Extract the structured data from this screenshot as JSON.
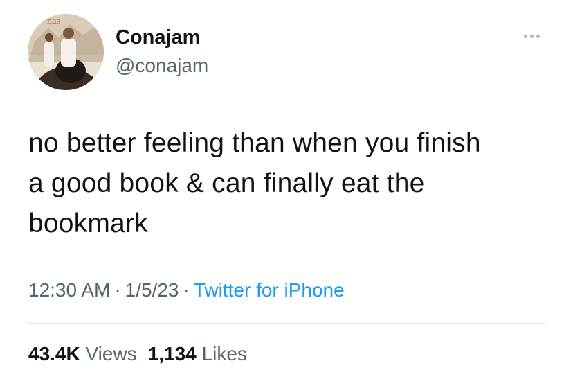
{
  "author": {
    "display_name": "Conajam",
    "handle": "@conajam",
    "avatar_label": "profile-photo"
  },
  "tweet": {
    "lines": [
      "no better feeling than when you finish",
      "a good book & can finally eat the",
      "bookmark"
    ]
  },
  "meta": {
    "time": "12:30 AM",
    "separator": "·",
    "date": "1/5/23",
    "source": "Twitter for iPhone"
  },
  "stats": {
    "views_count": "43.4K",
    "views_label": "Views",
    "likes_count": "1,134",
    "likes_label": "Likes"
  },
  "colors": {
    "text": "#0f1419",
    "secondary": "#536471",
    "link": "#1d9bf0",
    "divider": "#e1e8ed"
  },
  "icons": {
    "more": "more-dots-icon"
  }
}
